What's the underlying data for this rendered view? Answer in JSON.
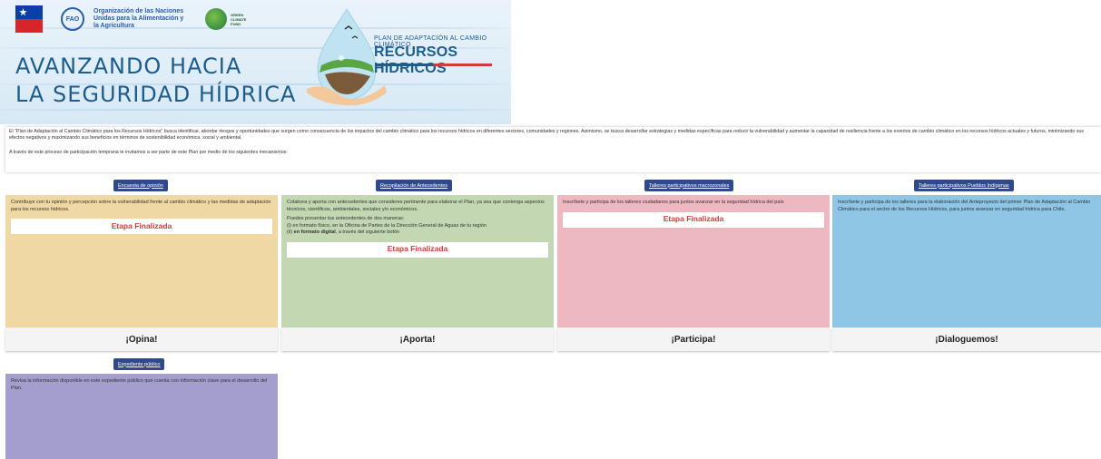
{
  "header": {
    "fao_text": "Organización de las Naciones Unidas para la Alimentación y la Agricultura",
    "fao_abbr": "FAO",
    "gcf_text": "GREEN CLIMATE FUND",
    "hero_line1": "AVANZANDO HACIA",
    "hero_line2": "LA SEGURIDAD HÍDRICA",
    "plan_small": "PLAN DE ADAPTACIÓN AL CAMBIO CLIMÁTICO",
    "plan_big": "RECURSOS HÍDRICOS"
  },
  "intro": {
    "paragraph1": "El \"Plan de Adaptación al Cambio Climático para los Recursos Hídricos\" busca identificar, abordar riesgos y oportunidades que surgen como consecuencia de los impactos del cambio climático para los recursos hídricos en diferentes sectores, comunidades y regiones. Asimismo, se busca desarrollar estrategias y medidas específicas para reducir la vulnerabilidad y aumentar la capacidad de resiliencia frente a los eventos de cambio climático en los recursos hídricos actuales y futuros, minimizando sus efectos negativos y maximizando sus beneficios en términos de sostenibilidad económica, social y ambiental.",
    "paragraph2": "A través de este proceso de participación temprana te invitamos a ser parte de este Plan por medio de los siguientes mecanismos:"
  },
  "cards": [
    {
      "button": "Encuesta de opinión",
      "text": "Contribuye con tu opinión y percepción sobre la vulnerabilidad frente al cambio climático y las medidas de adaptación para los recursos hídricos.",
      "status": "Etapa Finalizada",
      "footer": "¡Opina!"
    },
    {
      "button": "Recopilación de Antecedentes",
      "text": "Colabora y aporta con antecedentes que consideres pertinente para elaborar el Plan, ya sea que contenga aspectos técnicos, científicos, ambientales, sociales y/o económicos.",
      "text2": "Puedes presentar tus antecedentes de dos maneras:",
      "text3": "(i) en formato físico, en la Oficina de Partes de la Dirección General de Aguas de tu región",
      "text4_prefix": "(ii)",
      "text4_bold": "en formato digital",
      "text4_suffix": ", a través del siguiente botón",
      "status": "Etapa Finalizada",
      "footer": "¡Aporta!"
    },
    {
      "button": "Talleres participativos macrozonales",
      "text": "Inscríbete y participa de los talleres ciudadanos para juntos avanzar en la seguridad hídrica del país",
      "status": "Etapa Finalizada",
      "footer": "¡Participa!"
    },
    {
      "button": "Talleres participativos Pueblos Indígenas",
      "text": "Inscríbete y participa de los talleres para la elaboración del Anteproyecto del primer Plan de Adaptación al Cambio Climático para el sector de los Recursos Hídricos, para juntos avanzar en seguridad hídrica para Chile.",
      "footer": "¡Dialoguemos!"
    },
    {
      "button": "Expediente público",
      "text": "Revisa la información disponible en este expediente público que cuenta con información clave para el desarrollo del Plan."
    }
  ],
  "colors": {
    "yellow": "#efd8a4",
    "green": "#c3d8b2",
    "pink": "#eeb8c0",
    "blue": "#8fc6e6",
    "purple": "#a39ecd",
    "button": "#2f4a8a",
    "status_red": "#d33a3a"
  }
}
